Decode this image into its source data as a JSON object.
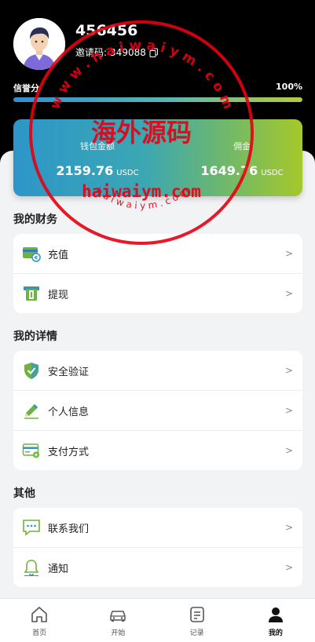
{
  "profile": {
    "user_id": "456456",
    "invite_label": "邀请码:",
    "invite_code": "349088"
  },
  "credit": {
    "label": "信誉分",
    "value_text": "100%",
    "value": 1.0
  },
  "wallet": {
    "balance_label": "钱包金额",
    "balance_value": "2159.76",
    "balance_unit": "USDC",
    "commission_label": "佣金",
    "commission_value": "1649.76",
    "commission_unit": "USDC"
  },
  "finance": {
    "title": "我的财务",
    "items": [
      {
        "label": "充值",
        "icon": "recharge-card-icon"
      },
      {
        "label": "提现",
        "icon": "withdraw-atm-icon"
      }
    ]
  },
  "details": {
    "title": "我的详情",
    "items": [
      {
        "label": "安全验证",
        "icon": "shield-check-icon"
      },
      {
        "label": "个人信息",
        "icon": "pencil-icon"
      },
      {
        "label": "支付方式",
        "icon": "payment-card-icon"
      }
    ]
  },
  "other": {
    "title": "其他",
    "items": [
      {
        "label": "联系我们",
        "icon": "chat-bubble-icon"
      },
      {
        "label": "通知",
        "icon": "bell-icon"
      }
    ]
  },
  "chevron": ">",
  "tabbar": [
    {
      "label": "首页",
      "icon": "home-icon"
    },
    {
      "label": "开始",
      "icon": "car-icon"
    },
    {
      "label": "记录",
      "icon": "records-icon"
    },
    {
      "label": "我的",
      "icon": "user-icon",
      "active": true
    }
  ],
  "watermark": {
    "arc_top": "w w w . h a i w a i y m . c o m",
    "main": "海外源码",
    "url": "haiwaiym.com",
    "arc_bottom": "h a i w a i y m . c o m"
  },
  "colors": {
    "header_bg": "#000000",
    "accent_green": "#6db33f",
    "accent_blue": "#2d96c8",
    "stamp_red": "#e60012"
  }
}
